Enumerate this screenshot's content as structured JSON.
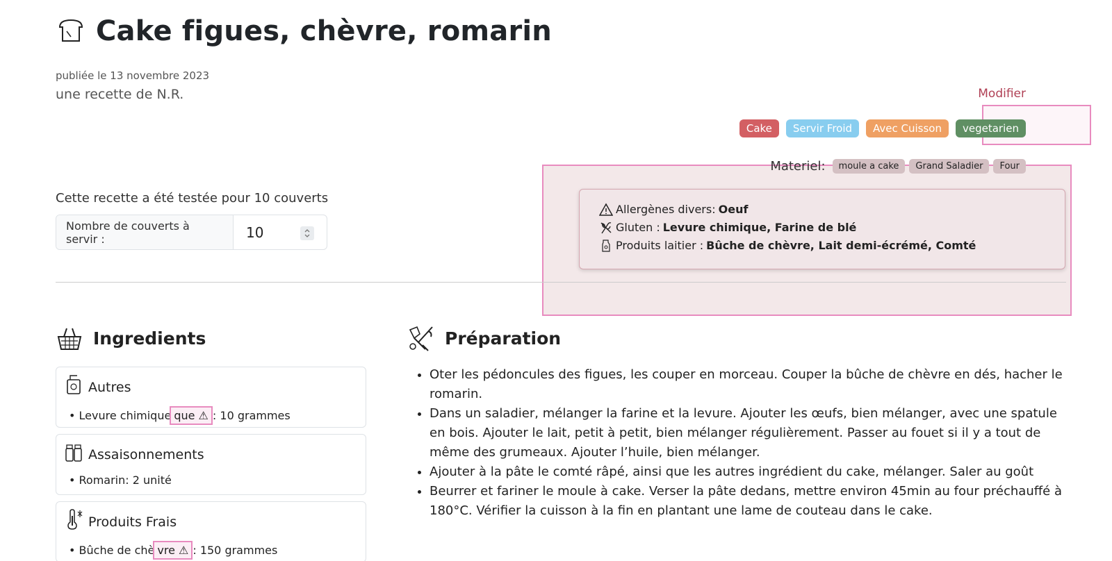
{
  "recipe": {
    "title": "Cake figues, chèvre, romarin",
    "published": "publiée le 13 novembre 2023",
    "author": "une recette de N.R.",
    "modify_label": "Modifier"
  },
  "tags": [
    "Cake",
    "Servir Froid",
    "Avec Cuisson",
    "vegetarien"
  ],
  "materiel": {
    "label": "Materiel:",
    "items": [
      "moule a cake",
      "Grand Saladier",
      "Four"
    ]
  },
  "allergens": {
    "divers_label": "Allergènes divers:",
    "divers_value": "Oeuf",
    "gluten_label": "Gluten :",
    "gluten_value": "Levure chimique, Farine de blé",
    "lait_label": "Produits laitier :",
    "lait_value": "Bûche de chèvre, Lait demi-écrémé, Comté"
  },
  "servings": {
    "tested_text": "Cette recette a été testée pour 10 couverts",
    "label": "Nombre de couverts à servir :",
    "value": "10"
  },
  "ingredients": {
    "title": "Ingredients",
    "groups": [
      {
        "name": "Autres",
        "item_name": "• Levure chimique",
        "warn_part": "que ⚠",
        "qty": ": 10 grammes"
      },
      {
        "name": "Assaisonnements",
        "item_name": "• Romarin",
        "qty": " : 2 unité"
      },
      {
        "name": "Produits Frais",
        "item_name": "• Bûche de chè",
        "warn_part": "vre ⚠",
        "qty": ": 150 grammes"
      }
    ]
  },
  "preparation": {
    "title": "Préparation",
    "steps": [
      "Oter les pédoncules des figues, les couper en morceau. Couper la bûche de chèvre en dés, hacher le romarin.",
      "Dans un saladier, mélanger la farine et la levure. Ajouter les œufs, bien mélanger, avec une spatule en bois. Ajouter le lait, petit à petit, bien mélanger régulièrement. Passer au fouet si il y a tout de même des grumeaux. Ajouter l’huile, bien mélanger.",
      "Ajouter à la pâte le comté râpé, ainsi que les autres ingrédient du cake, mélanger. Saler au goût",
      "Beurrer et fariner le moule à cake. Verser la pâte dedans, mettre environ 45min au four préchauffé à 180°C. Vérifier la cuisson à la fin en plantant une lame de couteau dans le cake."
    ]
  },
  "icons": [
    "bread-icon",
    "warning-icon",
    "wheat-icon",
    "milk-icon",
    "basket-icon",
    "tools-icon",
    "jar-icon",
    "spice-icon",
    "thermometer-icon"
  ]
}
